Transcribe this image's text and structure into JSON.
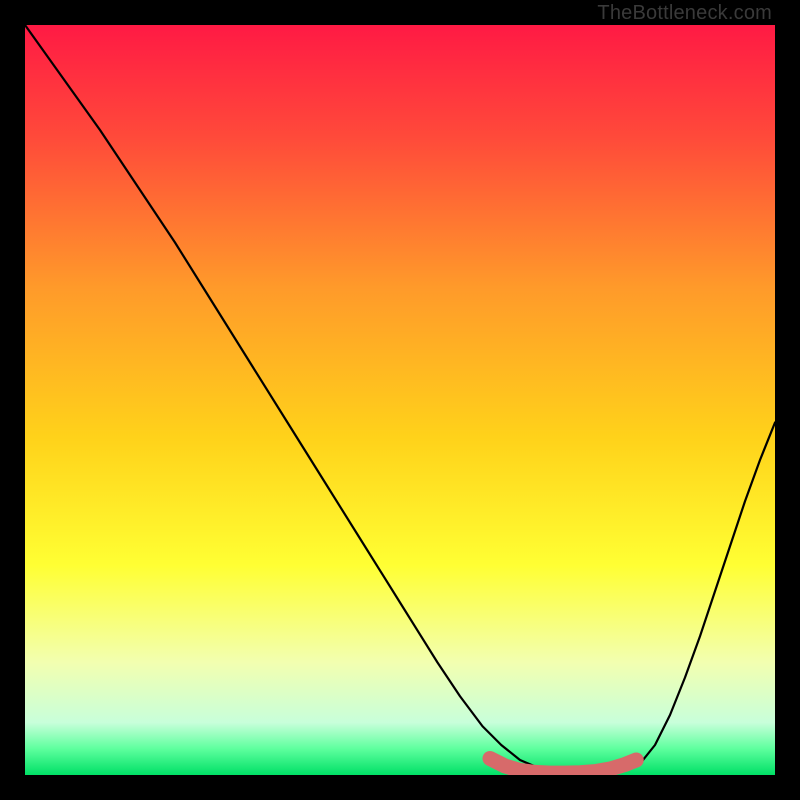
{
  "watermark": "TheBottleneck.com",
  "chart_data": {
    "type": "line",
    "title": "",
    "xlabel": "",
    "ylabel": "",
    "xlim": [
      0,
      100
    ],
    "ylim": [
      0,
      100
    ],
    "grid": false,
    "legend": false,
    "gradient_stops": [
      {
        "offset": 0.0,
        "color": "#ff1a44"
      },
      {
        "offset": 0.15,
        "color": "#ff4a3a"
      },
      {
        "offset": 0.35,
        "color": "#ff9a2a"
      },
      {
        "offset": 0.55,
        "color": "#ffd21a"
      },
      {
        "offset": 0.72,
        "color": "#ffff33"
      },
      {
        "offset": 0.85,
        "color": "#f2ffb0"
      },
      {
        "offset": 0.93,
        "color": "#c8ffda"
      },
      {
        "offset": 0.965,
        "color": "#5eff9e"
      },
      {
        "offset": 1.0,
        "color": "#00e066"
      }
    ],
    "series": [
      {
        "name": "curve-left",
        "x": [
          0,
          5,
          10,
          15,
          20,
          25,
          30,
          35,
          40,
          45,
          50,
          55,
          58,
          61,
          63.5,
          66,
          69.5
        ],
        "y": [
          100,
          93,
          86,
          78.5,
          71,
          63,
          55,
          47,
          39,
          31,
          23,
          15,
          10.5,
          6.5,
          4,
          2,
          0.5
        ]
      },
      {
        "name": "curve-right",
        "x": [
          82,
          84,
          86,
          88,
          90,
          92,
          94,
          96,
          98,
          100
        ],
        "y": [
          1.5,
          4,
          8,
          13,
          18.5,
          24.5,
          30.5,
          36.5,
          42,
          47
        ]
      },
      {
        "name": "optimal-band",
        "x": [
          62,
          64,
          66,
          68,
          70,
          72,
          74,
          76,
          78,
          80,
          81.5
        ],
        "y": [
          2.2,
          1.2,
          0.6,
          0.35,
          0.25,
          0.25,
          0.3,
          0.45,
          0.8,
          1.4,
          2.0
        ],
        "style": "thick-red"
      }
    ],
    "marker": {
      "x": 81.5,
      "y": 2.0,
      "color": "#d76a6a",
      "r": 6
    }
  }
}
